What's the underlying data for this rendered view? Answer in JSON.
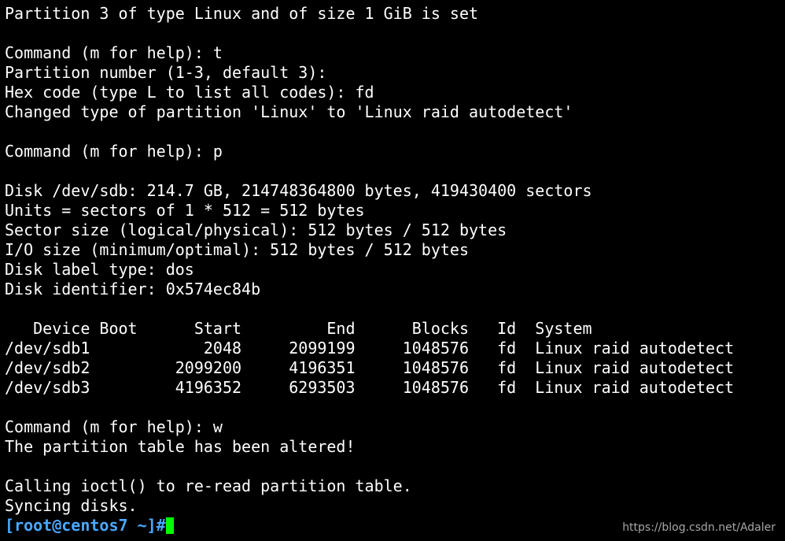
{
  "terminal": {
    "lines": [
      "Partition 3 of type Linux and of size 1 GiB is set",
      "",
      "Command (m for help): t",
      "Partition number (1-3, default 3):",
      "Hex code (type L to list all codes): fd",
      "Changed type of partition 'Linux' to 'Linux raid autodetect'",
      "",
      "Command (m for help): p",
      "",
      "Disk /dev/sdb: 214.7 GB, 214748364800 bytes, 419430400 sectors",
      "Units = sectors of 1 * 512 = 512 bytes",
      "Sector size (logical/physical): 512 bytes / 512 bytes",
      "I/O size (minimum/optimal): 512 bytes / 512 bytes",
      "Disk label type: dos",
      "Disk identifier: 0x574ec84b",
      "",
      "   Device Boot      Start         End      Blocks   Id  System",
      "/dev/sdb1            2048     2099199     1048576   fd  Linux raid autodetect",
      "/dev/sdb2         2099200     4196351     1048576   fd  Linux raid autodetect",
      "/dev/sdb3         4196352     6293503     1048576   fd  Linux raid autodetect",
      "",
      "Command (m for help): w",
      "The partition table has been altered!",
      "",
      "Calling ioctl() to re-read partition table.",
      "Syncing disks."
    ],
    "prompt": "[root@centos7 ~]#"
  },
  "watermark": "https://blog.csdn.net/Adaler",
  "colors": {
    "background": "#000000",
    "text": "#ffffff",
    "prompt": "#4aa8ff",
    "cursor": "#00ff00"
  }
}
